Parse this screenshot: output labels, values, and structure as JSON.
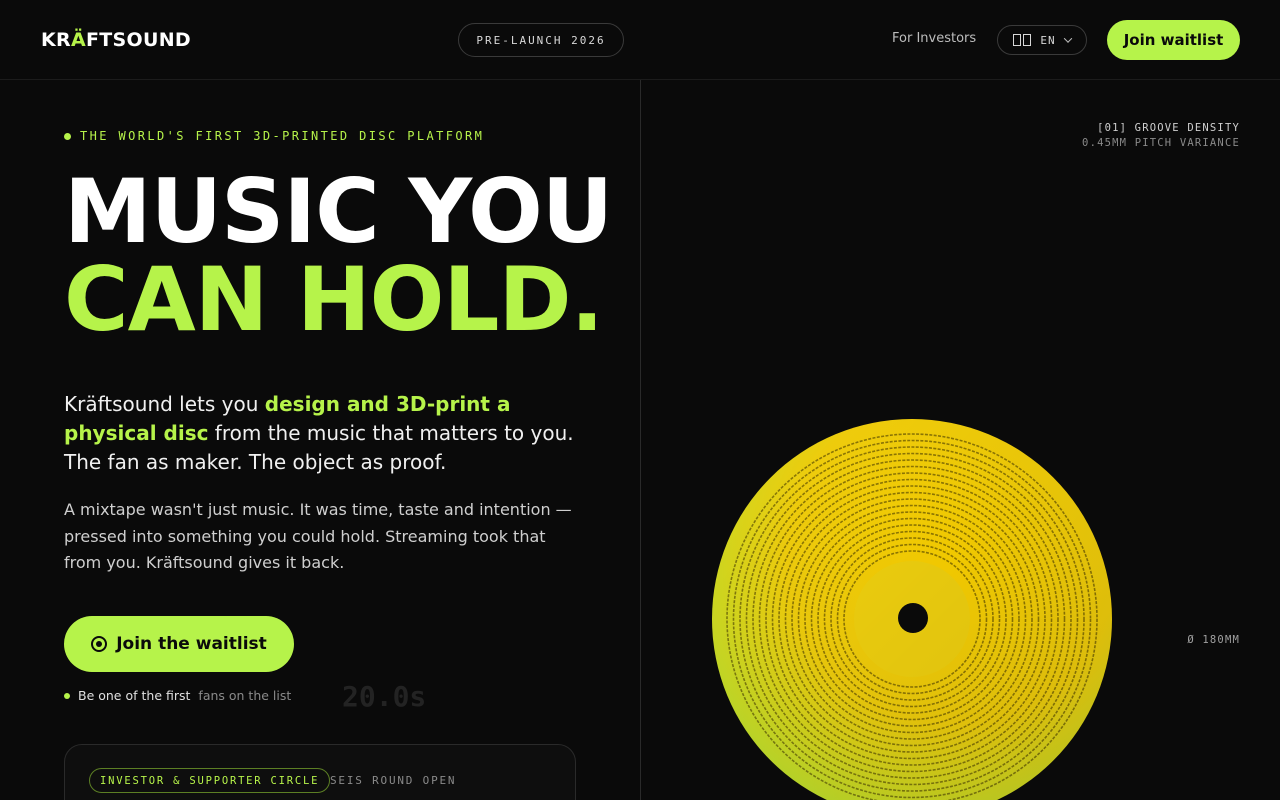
{
  "header": {
    "logo_prefix": "KR",
    "logo_accent": "Ä",
    "logo_suffix": "FTSOUND",
    "prelaunch_badge": "PRE-LAUNCH 2026",
    "investors_link": "For Investors",
    "language": "EN",
    "language_icon": "flag-icon",
    "cta": "Join waitlist"
  },
  "hero": {
    "eyebrow": "THE WORLD'S FIRST 3D-PRINTED DISC PLATFORM",
    "headline_line1": "MUSIC YOU",
    "headline_line2": "CAN HOLD.",
    "lead_start": "Kräftsound lets you ",
    "lead_highlight": "design and 3D-print a physical disc",
    "lead_end": " from the music that matters to you. The fan as maker. The object as proof.",
    "body": "A mixtape wasn't just music. It was time, taste and intention — pressed into something you could hold. Streaming took that from you. Kräftsound gives it back.",
    "cta": "Join the waitlist",
    "cta_icon": "target-icon",
    "fans_prefix": "Be one of the first",
    "fans_suffix": "fans on the list",
    "ghost_timer": "20.0s"
  },
  "investor_card": {
    "badge": "INVESTOR & SUPPORTER CIRCLE",
    "status": "SEIS ROUND OPEN"
  },
  "visual": {
    "spec_title": "[01] GROOVE DENSITY",
    "spec_value": "0.45MM PITCH VARIANCE",
    "diameter": "Ø 180MM"
  },
  "colors": {
    "accent": "#b6f34a",
    "background": "#0a0a0a",
    "disc_yellow": "#f6d40a"
  }
}
